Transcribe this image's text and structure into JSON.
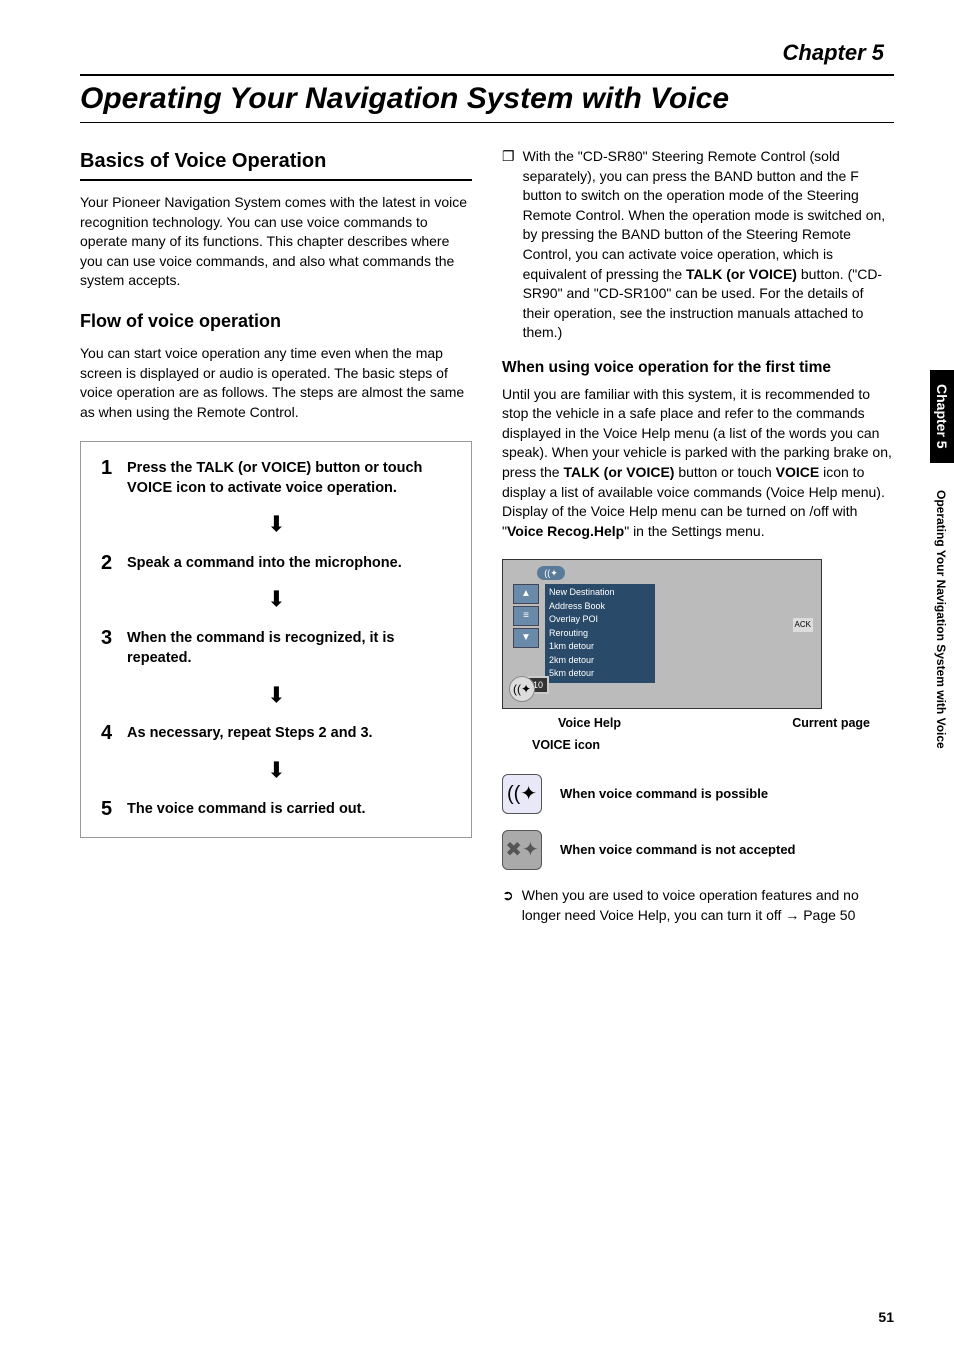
{
  "chapter_label": "Chapter 5",
  "title": "Operating Your Navigation System with Voice",
  "side_tab": "Chapter 5",
  "side_text": "Operating Your Navigation System with Voice",
  "page_number": "51",
  "left": {
    "h1": "Basics of Voice Operation",
    "p1": "Your Pioneer Navigation System comes with the latest in voice recognition technology. You can use voice commands to operate many of its functions. This chapter describes where you can use voice commands, and also what commands the system accepts.",
    "h2": "Flow of voice operation",
    "p2": "You can start voice operation any time even when the map screen is displayed or audio is operated. The basic steps of voice operation are as follows. The steps are almost the same as when using the Remote Control.",
    "steps": [
      {
        "num": "1",
        "pre": "Press the ",
        "b1": "TALK (or VOICE)",
        "mid": " button or touch ",
        "b2": "VOICE",
        "post": " icon to activate voice operation."
      },
      {
        "num": "2",
        "text": "Speak a command into the microphone."
      },
      {
        "num": "3",
        "text": "When the command is recognized, it is repeated."
      },
      {
        "num": "4",
        "text": "As necessary, repeat Steps 2 and 3."
      },
      {
        "num": "5",
        "text": "The voice command is carried out."
      }
    ]
  },
  "right": {
    "note1_pre": "With the \"CD-SR80\" Steering Remote Control (sold separately), you can press the BAND button and the F button to switch on the operation mode of the Steering Remote Control. When the operation mode is switched on, by pressing the BAND button of the Steering Remote Control, you can activate voice operation, which is equivalent of pressing the ",
    "note1_bold": "TALK (or VOICE)",
    "note1_post": " button. (\"CD-SR90\" and \"CD-SR100\" can be used. For the details of their operation, see the instruction manuals attached to them.)",
    "h3": "When using voice operation for the first time",
    "p3_pre": "Until you are familiar with this system, it is recommended to stop the vehicle in a safe place and refer to the commands displayed in the Voice Help menu (a list of the words you can speak). When your vehicle is parked with the parking brake on, press the ",
    "p3_b1": "TALK (or VOICE)",
    "p3_mid1": " button or touch ",
    "p3_b2": "VOICE",
    "p3_mid2": " icon to display a list of available voice commands (Voice Help menu). Display of the Voice Help menu can be turned on /off with \"",
    "p3_b3": "Voice Recog.Help",
    "p3_post": "\" in the Settings menu.",
    "menu_items": [
      "New Destination",
      "Address Book",
      "Overlay POI",
      "Rerouting",
      "1km detour",
      "2km detour",
      "5km detour"
    ],
    "page_ind": "1/10",
    "ack": "ACK",
    "label_voice_help": "Voice Help",
    "label_current_page": "Current page",
    "label_voice_icon": "VOICE icon",
    "icon1_text": "When voice command is possible",
    "icon2_text": "When voice command is not accepted",
    "tip_pre": "When you are used to voice operation features and no longer need Voice Help, you can turn it off ",
    "tip_ref": " Page 50"
  }
}
